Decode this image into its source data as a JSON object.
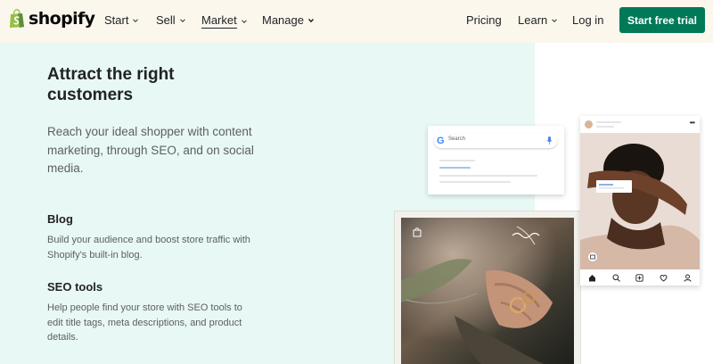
{
  "brand": {
    "name": "shopify",
    "accent_color": "#007958",
    "logo_bag_color": "#95bf47"
  },
  "nav": {
    "start": "Start",
    "sell": "Sell",
    "market": "Market",
    "manage": "Manage",
    "pricing": "Pricing",
    "learn": "Learn",
    "login": "Log in",
    "cta": "Start free trial"
  },
  "hero": {
    "headline": "Attract the right customers",
    "description": "Reach your ideal shopper with content marketing, through SEO, and on social media."
  },
  "features": [
    {
      "title": "Blog",
      "text": "Build your audience and boost store traffic with Shopify's built-in blog."
    },
    {
      "title": "SEO tools",
      "text": "Help people find your store with SEO tools to edit title tags, meta descriptions, and product details."
    }
  ],
  "search_card": {
    "placeholder": "Search"
  },
  "post_card": {
    "dots": "•••"
  }
}
